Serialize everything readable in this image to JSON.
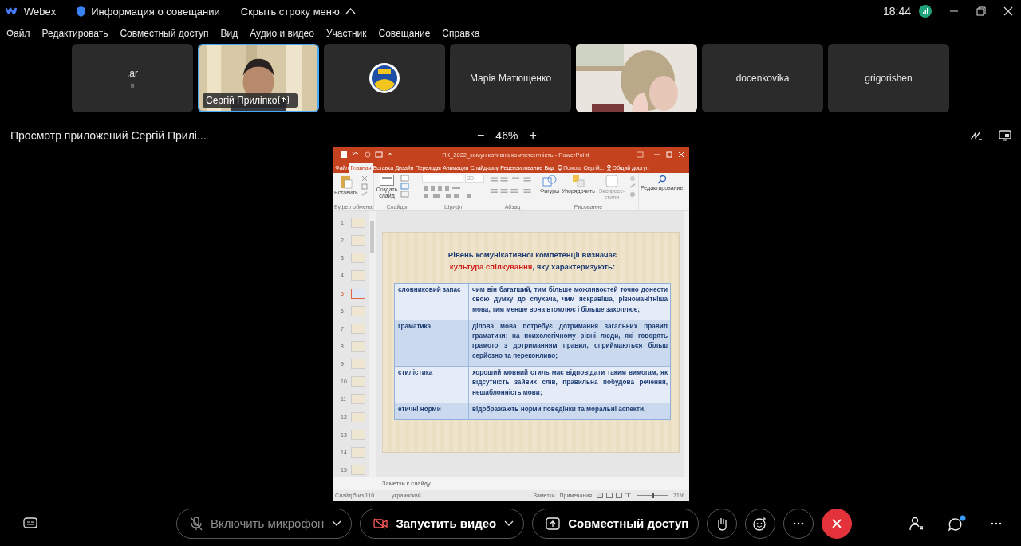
{
  "window": {
    "app_name": "Webex",
    "meeting_info": "Информация о совещании",
    "hide_menu": "Скрыть строку меню",
    "time": "18:44"
  },
  "menu": [
    "Файл",
    "Редактировать",
    "Совместный доступ",
    "Вид",
    "Аудио и видео",
    "Участник",
    "Совещание",
    "Справка"
  ],
  "participants": [
    {
      "kind": "name",
      "name": ",ar",
      "subtitle": "я",
      "selected": false
    },
    {
      "kind": "video",
      "name": "Сергій Приліпко",
      "sharing": true,
      "selected": true
    },
    {
      "kind": "logo",
      "selected": false
    },
    {
      "kind": "name",
      "name": "Марія Матющенко",
      "selected": false
    },
    {
      "kind": "video",
      "selected": false
    },
    {
      "kind": "name",
      "name": "docenkovika",
      "selected": false
    },
    {
      "kind": "name",
      "name": "grigorishen",
      "selected": false
    }
  ],
  "share_view": {
    "title": "Просмотр приложений Сергій Прилі...",
    "zoom_out": "−",
    "zoom": "46%",
    "zoom_in": "+"
  },
  "powerpoint": {
    "title": "ПК_2022_комунікативна компетентність - PowerPoint",
    "tabs": [
      {
        "label": "Файл",
        "selected": false
      },
      {
        "label": "Главная",
        "selected": true
      },
      {
        "label": "Вставка",
        "selected": false
      },
      {
        "label": "Дизайн",
        "selected": false
      },
      {
        "label": "Переходы",
        "selected": false
      },
      {
        "label": "Анимация",
        "selected": false
      },
      {
        "label": "Слайд-шоу",
        "selected": false
      },
      {
        "label": "Рецензирование",
        "selected": false
      },
      {
        "label": "Вид",
        "selected": false
      }
    ],
    "help": "Помощ",
    "user": "Сергій...",
    "share": "Общий доступ",
    "ribbon": {
      "paste": "Вставить",
      "new_slide": "Создать слайд",
      "font_size": "20",
      "shapes": "Фигуры",
      "arrange": "Упорядочить",
      "quick_styles": "Экспресс-стили",
      "editing": "Редактирование"
    },
    "groups": [
      "Буфер обмена",
      "Слайды",
      "Шрифт",
      "Абзац",
      "Рисование"
    ],
    "thumbnails": [
      {
        "number": "1",
        "selected": false
      },
      {
        "number": "2",
        "selected": false
      },
      {
        "number": "3",
        "selected": false
      },
      {
        "number": "4",
        "selected": false
      },
      {
        "number": "5",
        "selected": true
      },
      {
        "number": "6",
        "selected": false
      },
      {
        "number": "7",
        "selected": false
      },
      {
        "number": "8",
        "selected": false
      },
      {
        "number": "9",
        "selected": false
      },
      {
        "number": "10",
        "selected": false
      },
      {
        "number": "11",
        "selected": false
      },
      {
        "number": "12",
        "selected": false
      },
      {
        "number": "13",
        "selected": false
      },
      {
        "number": "14",
        "selected": false
      },
      {
        "number": "15",
        "selected": false
      }
    ],
    "slide": {
      "title_start": "Рівень комунікативної компетенції визначає",
      "title_highlight": "культура спілкування",
      "title_end": ", яку характеризують:",
      "rows": [
        {
          "term": "словниковий запас",
          "description": "чим він багатший, тим більше можливостей точно донести свою думку до слухача, чим яскравіша, різноманітніша мова, тим менше вона втомлює і більше захоплює;"
        },
        {
          "term": "граматика",
          "description": "ділова мова потребує дотримання загальних правил граматики; на психологічному рівні люди, які говорять грамото з дотриманням правил, сприймаються більш серйозно та переконливо;"
        },
        {
          "term": "стилістика",
          "description": "хороший мовний стиль має відповідати таким вимогам, як відсутність зайвих слів, правильна побудова речення, нешаблонність мови;"
        },
        {
          "term": "етичні норми",
          "description": "відображають норми поведінки та моральні аспекти."
        }
      ]
    },
    "notes": "Заметки к слайду",
    "status": {
      "slide": "Слайд 5 из 110",
      "language": "украинский",
      "notes": "Заметки",
      "comments": "Примечания",
      "zoom": "71%",
      "level": 0.5
    }
  },
  "controls": {
    "mic": {
      "label": "Включить микрофон",
      "muted": true
    },
    "video": {
      "label": "Запустить видео"
    },
    "share": {
      "label": "Совместный доступ"
    }
  },
  "chat": {
    "unread": true
  }
}
